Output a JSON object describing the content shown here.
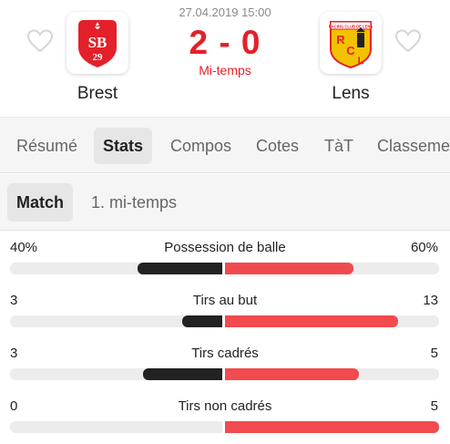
{
  "match": {
    "datetime": "27.04.2019 15:00",
    "score": "2 - 0",
    "status": "Mi-temps",
    "home": {
      "name": "Brest",
      "logo_text": "SB29",
      "favorite": false
    },
    "away": {
      "name": "Lens",
      "logo_text": "RCL",
      "logo_caption": "RACING CLUB DE LENS",
      "favorite": false
    }
  },
  "tabs": [
    {
      "label": "Résumé",
      "active": false
    },
    {
      "label": "Stats",
      "active": true
    },
    {
      "label": "Compos",
      "active": false
    },
    {
      "label": "Cotes",
      "active": false
    },
    {
      "label": "TàT",
      "active": false
    },
    {
      "label": "Classeme",
      "active": false
    }
  ],
  "subtabs": [
    {
      "label": "Match",
      "active": true
    },
    {
      "label": "1. mi-temps",
      "active": false
    }
  ],
  "stats": [
    {
      "label": "Possession de balle",
      "home": "40%",
      "away": "60%",
      "home_share": 0.4,
      "away_share": 0.6
    },
    {
      "label": "Tirs au but",
      "home": "3",
      "away": "13",
      "home_share": 0.19,
      "away_share": 0.81
    },
    {
      "label": "Tirs cadrés",
      "home": "3",
      "away": "5",
      "home_share": 0.375,
      "away_share": 0.625
    },
    {
      "label": "Tirs non cadrés",
      "home": "0",
      "away": "5",
      "home_share": 0.0,
      "away_share": 1.0
    }
  ],
  "colors": {
    "accent": "#e4202a",
    "home_bar": "#222222",
    "away_bar": "#f14a4f",
    "track": "#ececec"
  }
}
